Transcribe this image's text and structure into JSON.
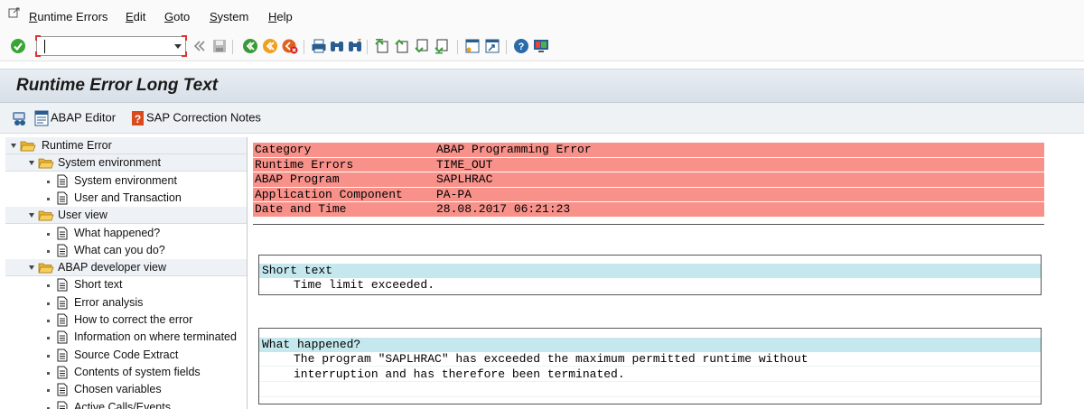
{
  "menubar": {
    "items": [
      {
        "label": "Runtime Errors",
        "accel": "R",
        "rest": "untime Errors"
      },
      {
        "label": "Edit",
        "accel": "E",
        "rest": "dit"
      },
      {
        "label": "Goto",
        "accel": "G",
        "rest": "oto"
      },
      {
        "label": "System",
        "accel": "S",
        "rest": "ystem"
      },
      {
        "label": "Help",
        "accel": "H",
        "rest": "elp"
      }
    ]
  },
  "toolbar": {
    "command_value": "",
    "icons": [
      "enter-icon",
      "command-field",
      "back-double-icon",
      "save-icon",
      "back-icon",
      "exit-icon",
      "cancel-icon",
      "print-icon",
      "find-icon",
      "find-next-icon",
      "first-page-icon",
      "previous-page-icon",
      "next-page-icon",
      "last-page-icon",
      "new-session-icon",
      "shortcut-icon",
      "help-icon",
      "customize-layout-icon"
    ]
  },
  "title": "Runtime Error Long Text",
  "app_toolbar": {
    "buttons": [
      {
        "label": "",
        "icon": "debugger-icon"
      },
      {
        "label": "ABAP Editor",
        "icon": "abap-editor-icon"
      },
      {
        "label": "SAP Correction Notes",
        "icon": "correction-notes-icon"
      }
    ]
  },
  "tree": {
    "nodes": [
      {
        "label": "Runtime Error",
        "type": "folder",
        "level": 0
      },
      {
        "label": "System environment",
        "type": "folder",
        "level": 1
      },
      {
        "label": "System environment",
        "type": "doc",
        "level": 2
      },
      {
        "label": "User and Transaction",
        "type": "doc",
        "level": 2
      },
      {
        "label": "User view",
        "type": "folder",
        "level": 1
      },
      {
        "label": "What happened?",
        "type": "doc",
        "level": 2
      },
      {
        "label": "What can you do?",
        "type": "doc",
        "level": 2
      },
      {
        "label": "ABAP developer view",
        "type": "folder",
        "level": 1
      },
      {
        "label": "Short text",
        "type": "doc",
        "level": 2
      },
      {
        "label": "Error analysis",
        "type": "doc",
        "level": 2
      },
      {
        "label": "How to correct the error",
        "type": "doc",
        "level": 2
      },
      {
        "label": "Information on where terminated",
        "type": "doc",
        "level": 2
      },
      {
        "label": "Source Code Extract",
        "type": "doc",
        "level": 2
      },
      {
        "label": "Contents of system fields",
        "type": "doc",
        "level": 2
      },
      {
        "label": "Chosen variables",
        "type": "doc",
        "level": 2
      },
      {
        "label": "Active Calls/Events",
        "type": "doc",
        "level": 2
      }
    ]
  },
  "header_table": [
    {
      "key": "Category",
      "value": "ABAP Programming Error"
    },
    {
      "key": "Runtime Errors",
      "value": "TIME_OUT"
    },
    {
      "key": "ABAP Program",
      "value": "SAPLHRAC"
    },
    {
      "key": "Application Component",
      "value": "PA-PA"
    },
    {
      "key": "Date and Time",
      "value": "28.08.2017 06:21:23"
    }
  ],
  "short_text": {
    "heading": "Short text",
    "lines": [
      "Time limit exceeded."
    ]
  },
  "what_happened": {
    "heading": "What happened?",
    "lines": [
      "The program \"SAPLHRAC\" has exceeded the maximum permitted runtime without",
      "interruption and has therefore been terminated.",
      ""
    ]
  },
  "colors": {
    "header_row": "#f7918a",
    "section_head": "#c4e8ee",
    "title_bg": "#dde4ea"
  }
}
